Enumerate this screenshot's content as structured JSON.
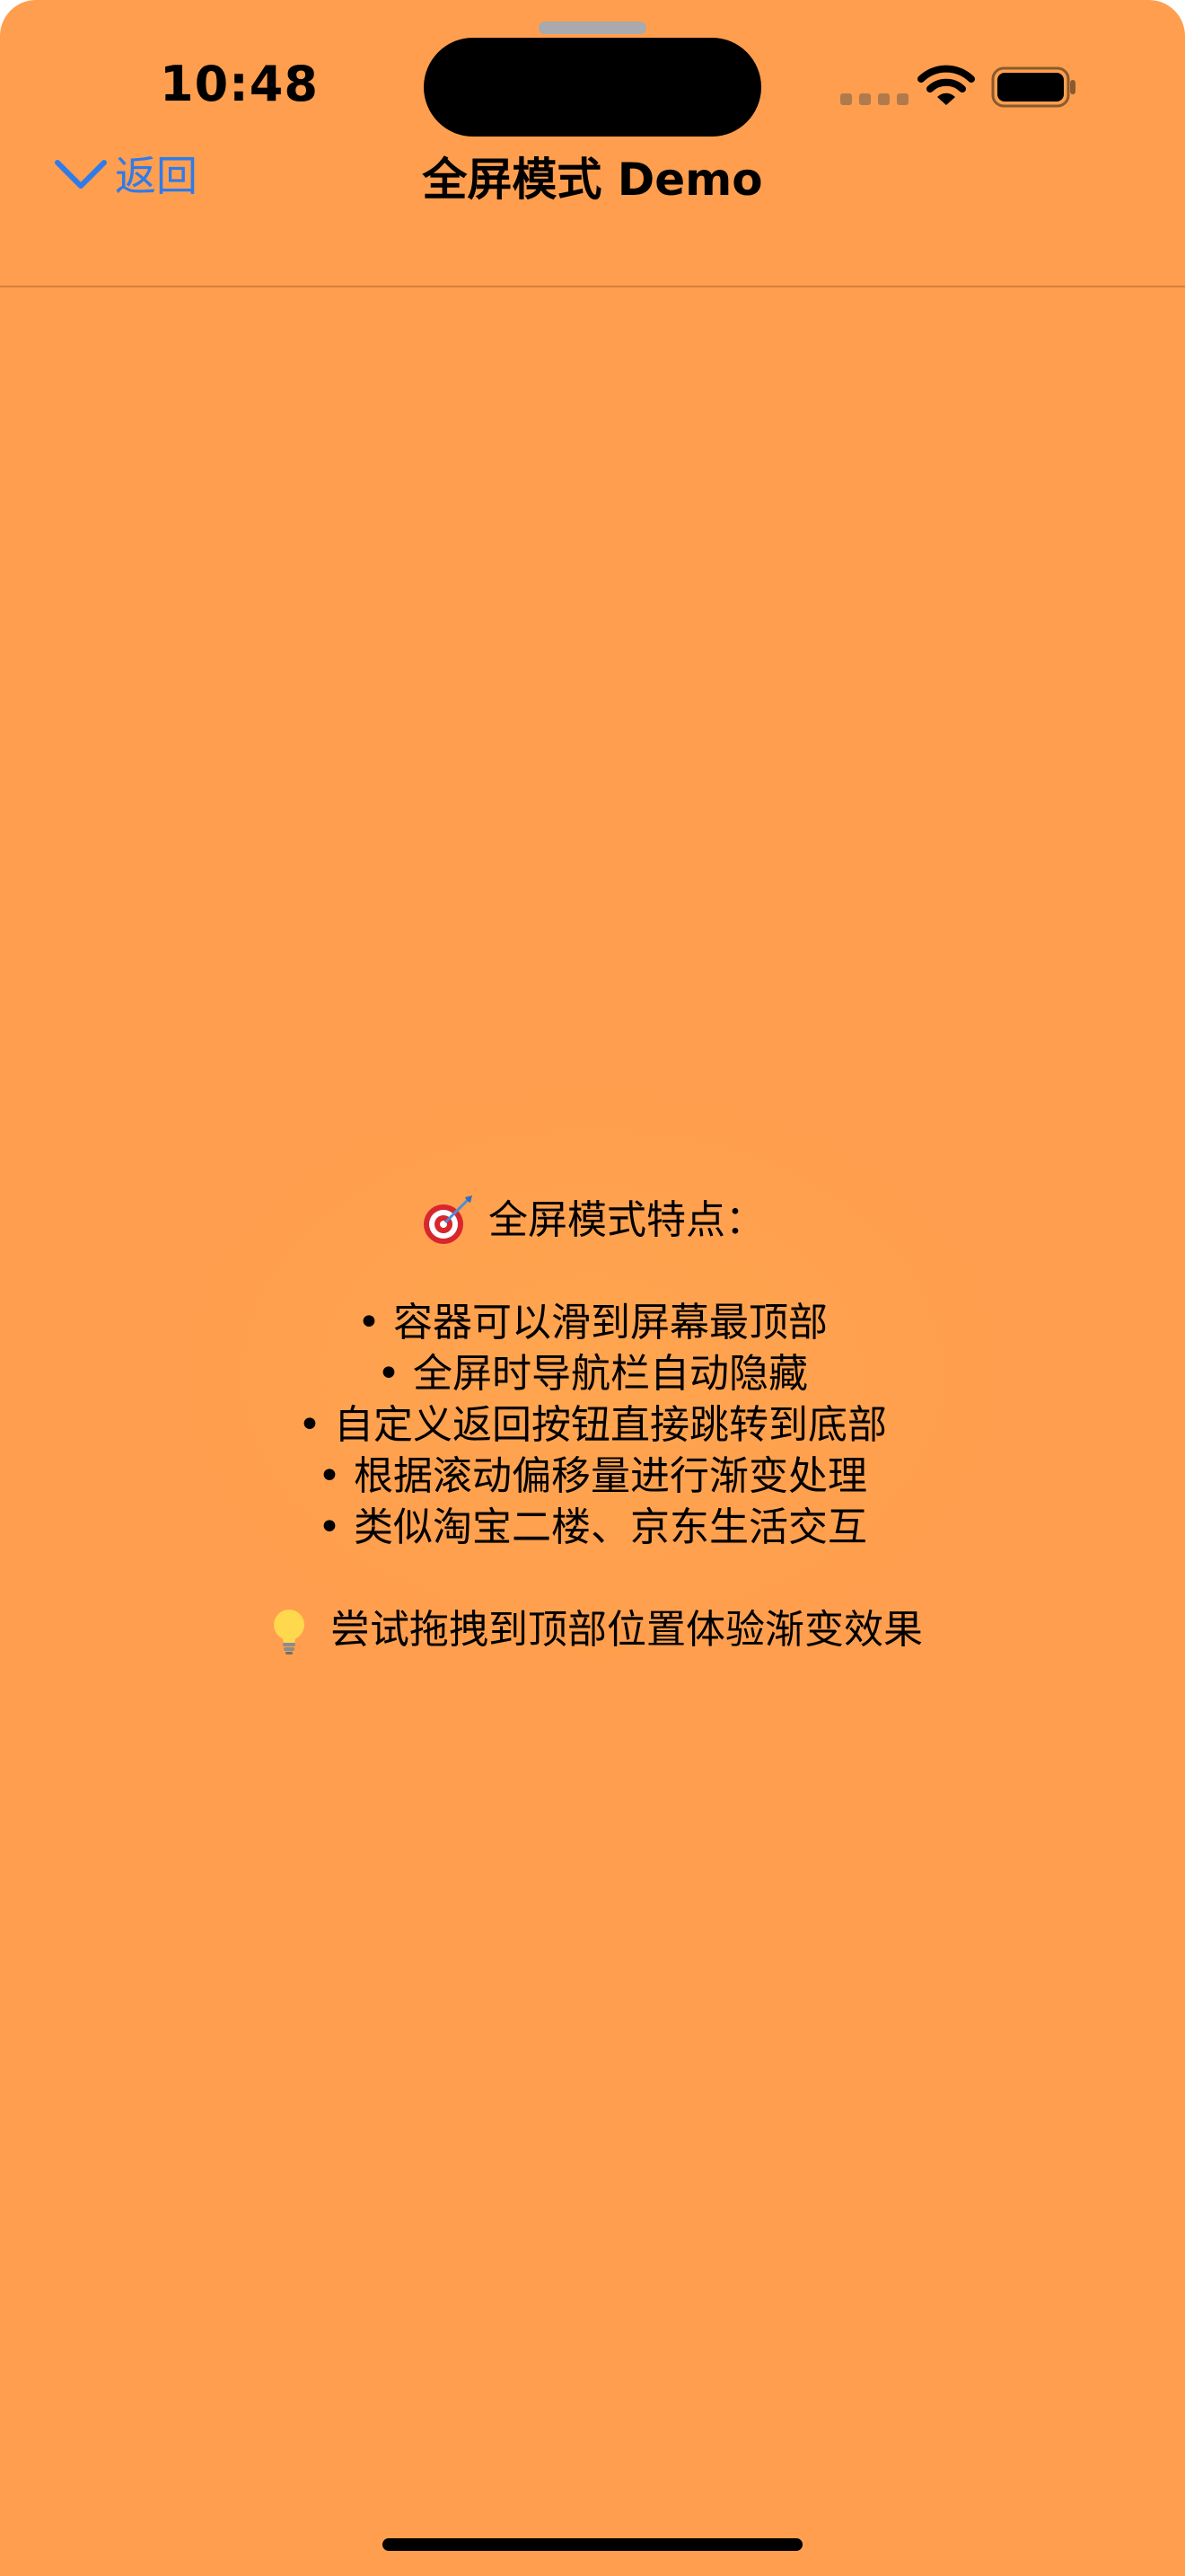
{
  "status_bar": {
    "time": "10:48"
  },
  "nav": {
    "back_label": "返回",
    "title": "全屏模式 Demo"
  },
  "content": {
    "features_title": "全屏模式特点：",
    "features": [
      "• 容器可以滑到屏幕最顶部",
      "• 全屏时导航栏自动隐藏",
      "• 自定义返回按钮直接跳转到底部",
      "• 根据滚动偏移量进行渐变处理",
      "• 类似淘宝二楼、京东生活交互"
    ],
    "tip": "尝试拖拽到顶部位置体验渐变效果"
  },
  "icons": {
    "features_title": "dart-target-emoji-icon",
    "tip": "light-bulb-emoji-icon",
    "back": "chevron-down-icon"
  },
  "colors": {
    "background": "#FF9E4E",
    "accent": "#2F7BEA"
  }
}
